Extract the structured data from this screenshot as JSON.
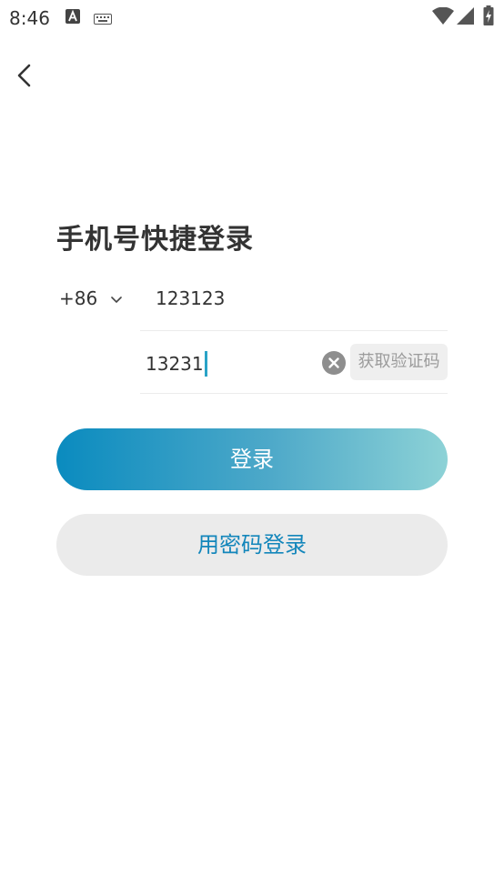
{
  "status_bar": {
    "time": "8:46",
    "icons": [
      "a-notification-icon",
      "keyboard-icon",
      "wifi-icon",
      "signal-icon",
      "battery-charging-icon"
    ]
  },
  "nav": {
    "back_icon": "chevron-left-icon"
  },
  "title": "手机号快捷登录",
  "form": {
    "country_code": "+86",
    "country_dropdown_icon": "chevron-down-icon",
    "phone_value": "123123",
    "code_value": "13231",
    "clear_icon": "clear-circle-icon",
    "get_code_label": "获取验证码"
  },
  "buttons": {
    "login_label": "登录",
    "password_login_label": "用密码登录"
  },
  "colors": {
    "accent": "#0a8bbf",
    "gradient_end": "#8dd2d6",
    "link_text": "#1386bb",
    "secondary_bg": "#ebebeb"
  }
}
